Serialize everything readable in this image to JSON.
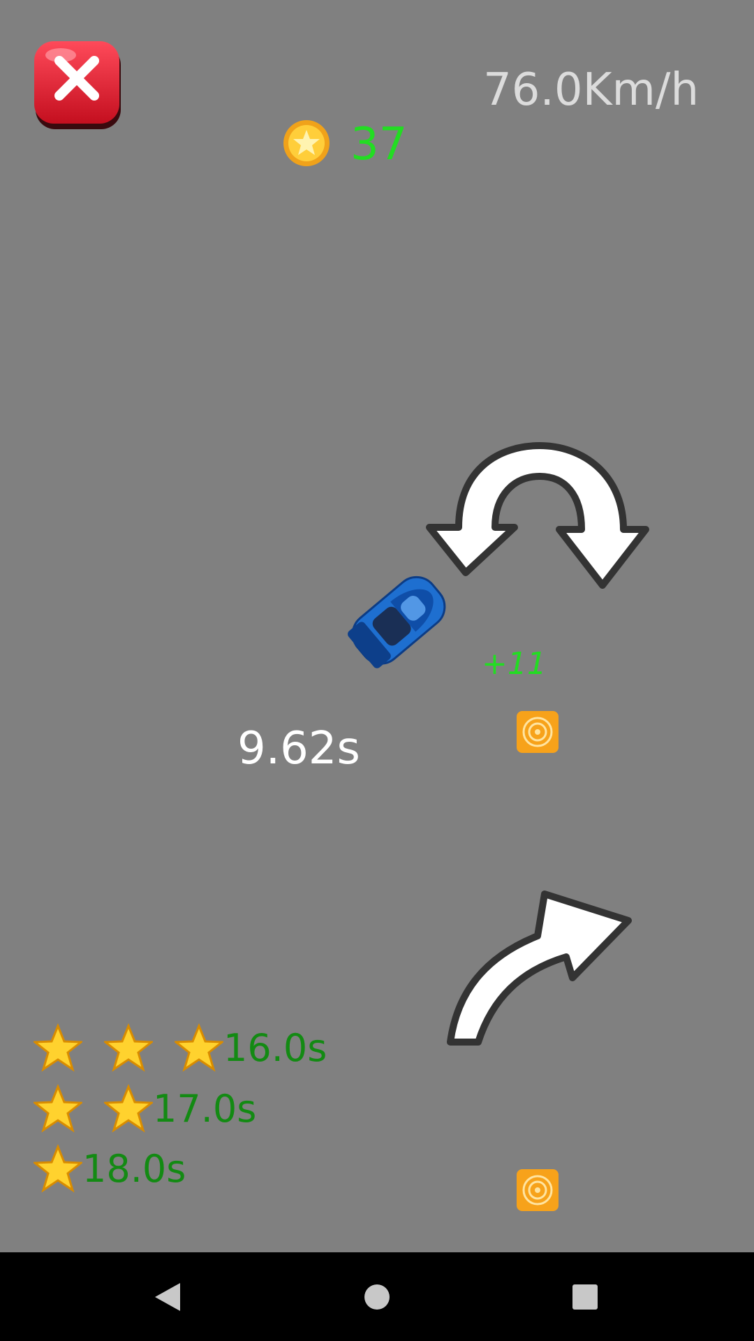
{
  "hud": {
    "speed": "76.0Km/h",
    "coins": "37",
    "timer": "9.62s",
    "bonus_popup": "+11"
  },
  "star_targets": [
    {
      "stars": 3,
      "time": "16.0s"
    },
    {
      "stars": 2,
      "time": "17.0s"
    },
    {
      "stars": 1,
      "time": "18.0s"
    }
  ],
  "icons": {
    "close": "close-icon",
    "coin": "coin-icon",
    "u_turn": "u-turn-arrow-icon",
    "turn_right": "turn-right-arrow-icon",
    "car": "blue-car",
    "target": "target-marker-icon",
    "star": "star-icon"
  },
  "colors": {
    "background": "#808080",
    "coin_text": "#22dd22",
    "star_time_text": "#138a13",
    "timer_text": "#ffffff",
    "speed_text": "#dcdcdc",
    "close_button": "#e0182a",
    "car": "#1e6fd0"
  },
  "system_nav": {
    "back": "back-icon",
    "home": "home-icon",
    "recents": "recents-icon"
  }
}
